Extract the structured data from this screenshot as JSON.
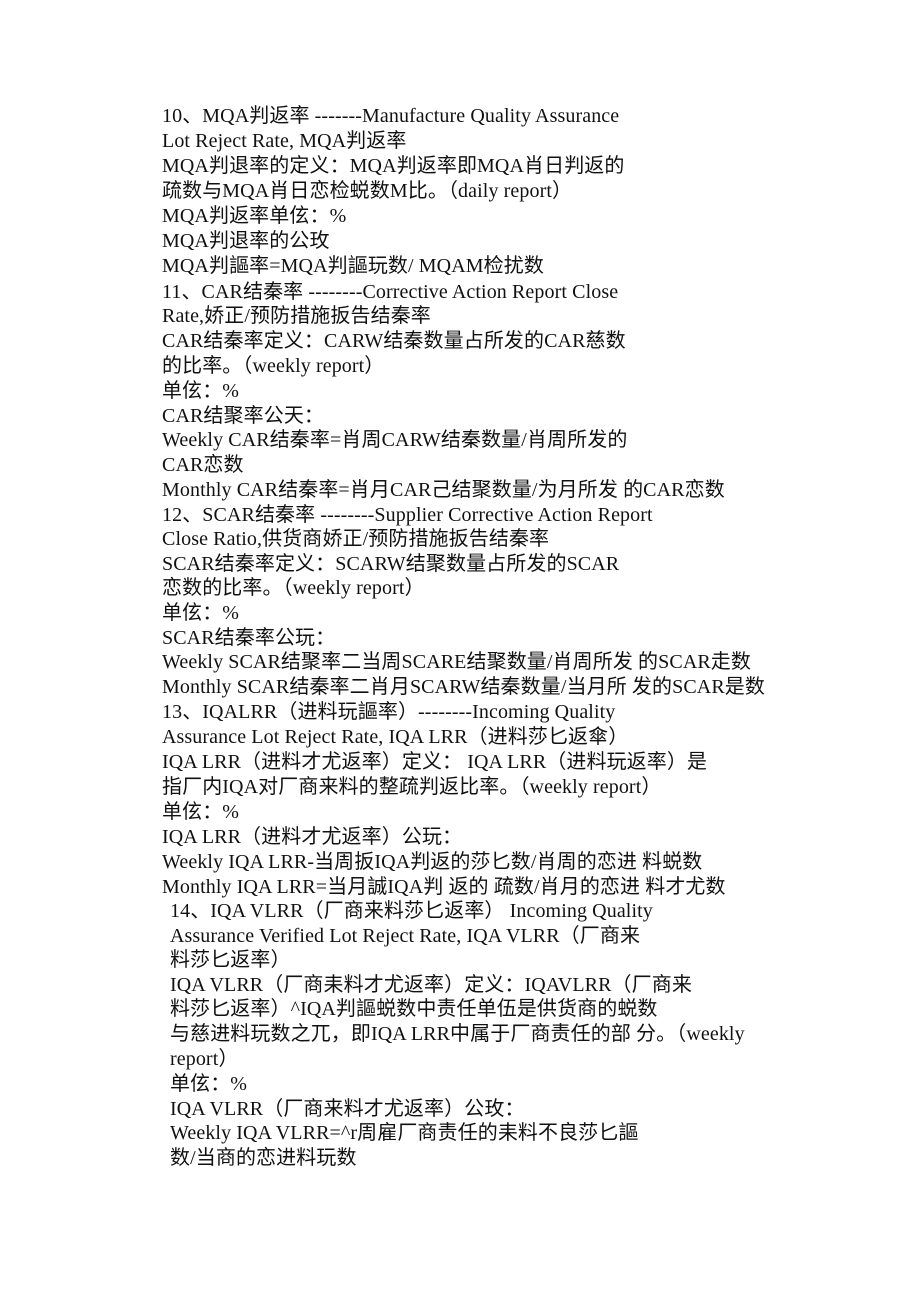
{
  "document": {
    "sections": [
      {
        "id": "10",
        "lines": [
          "10、MQA判返率 -------Manufacture Quality Assurance",
          "Lot Reject Rate, MQA判返率",
          "MQA判退率的定义：MQA判返率即MQA肖日判返的",
          "疏数与MQA肖日恋检蜕数M比。（daily report）",
          "MQA判返率单伭：%",
          "MQA判退率的公玫",
          "MQA判謳率=MQA判謳玩数/  MQAM检扰数"
        ]
      },
      {
        "id": "11",
        "lines": [
          "11、CAR结秦率 --------Corrective Action Report Close",
          "Rate,娇正/预防措施扳告结秦率",
          "CAR结秦率定义：CARW结秦数量占所发的CAR慈数",
          "的比率。（weekly report）",
          "单伭：%",
          "CAR结聚率公天：",
          "Weekly CAR结秦率=肖周CARW结秦数量/肖周所发的",
          "CAR恋数",
          "Monthly CAR结秦率=肖月CAR己结聚数量/为月所发  的CAR恋数"
        ]
      },
      {
        "id": "12",
        "lines": [
          "12、SCAR结秦率 --------Supplier Corrective Action Report",
          "Close Ratio,供货商娇正/预防措施扳告结秦率",
          "SCAR结秦率定义：SCARW结聚数量占所发的SCAR",
          "恋数的比率。（weekly report）",
          "单伭：%",
          "SCAR结秦率公玩：",
          "Weekly SCAR结聚率二当周SCARE结聚数量/肖周所发  的SCAR走数",
          "Monthly SCAR结秦率二肖月SCARW结秦数量/当月所  发的SCAR是数"
        ]
      },
      {
        "id": "13",
        "lines": [
          "13、IQALRR（进料玩謳率）--------Incoming Quality",
          "Assurance Lot Reject Rate, IQA LRR（进料莎匕返傘）",
          "IQA LRR（进料才尤返率）定义： IQA LRR（进料玩返率）是",
          "指厂内IQA对厂商来料的整疏判返比率。（weekly report）",
          "单伭：%",
          "IQA LRR（进料才尤返率）公玩：",
          "Weekly IQA LRR-当周扳IQA判返的莎匕数/肖周的恋进  料蜕数",
          " Monthly IQA LRR=当月誠IQA判  返的  疏数/肖月的恋进  料才尤数"
        ]
      },
      {
        "id": "14",
        "lines": [
          "14、IQA VLRR（厂商来料莎匕返率） Incoming Quality",
          "Assurance Verified Lot Reject Rate, IQA VLRR（厂商来",
          "料莎匕返率）",
          "IQA VLRR（厂商耒料才尤返率）定义：IQAVLRR（厂商来",
          "料莎匕返率）^IQA判謳蜕数中责任单伍是供货商的蜕数",
          "与慈进料玩数之兀，即IQA LRR中属于厂商责任的部  分。（weekly",
          "report）",
          "单伭：%",
          "IQA VLRR（厂商来料才尤返率）公玫：",
          "Weekly IQA VLRR=^r周雇厂商责任的耒料不良莎匕謳",
          "数/当商的恋进料玩数"
        ]
      }
    ]
  }
}
